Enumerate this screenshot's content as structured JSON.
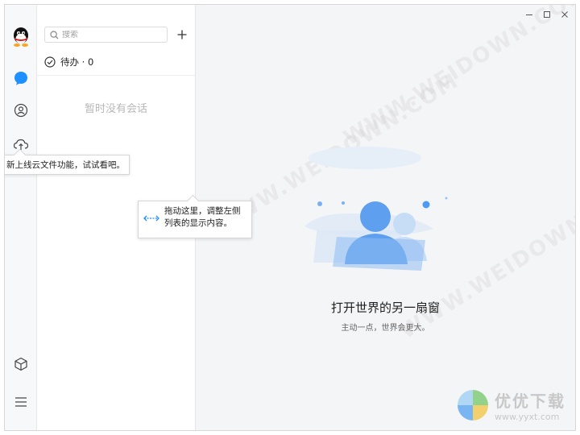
{
  "search": {
    "placeholder": "搜索"
  },
  "todo": {
    "label": "待办 · 0"
  },
  "session_list": {
    "empty_text": "暂时没有会话"
  },
  "tooltips": {
    "cloud_file": "新上线云文件功能，试试看吧。",
    "drag_line1": "拖动这里，调整左侧",
    "drag_line2": "列表的显示内容。"
  },
  "main": {
    "slogan": "打开世界的另一扇窗",
    "subtitle": "主动一点，世界会更大。"
  },
  "watermark": {
    "site_text": "WWW.WEIDOWN.COM",
    "brand_name": "优优下载",
    "brand_url": "www.yyxt.com"
  },
  "icons": {
    "rail": [
      "qq-avatar-icon",
      "message-icon",
      "contacts-icon",
      "cloud-icon",
      "cube-icon",
      "menu-icon"
    ],
    "window": [
      "minimize-icon",
      "maximize-icon",
      "close-icon"
    ]
  },
  "colors": {
    "accent": "#1e90ff",
    "rail_bg": "#f7f8fa",
    "main_bg": "#f4f5f7"
  }
}
